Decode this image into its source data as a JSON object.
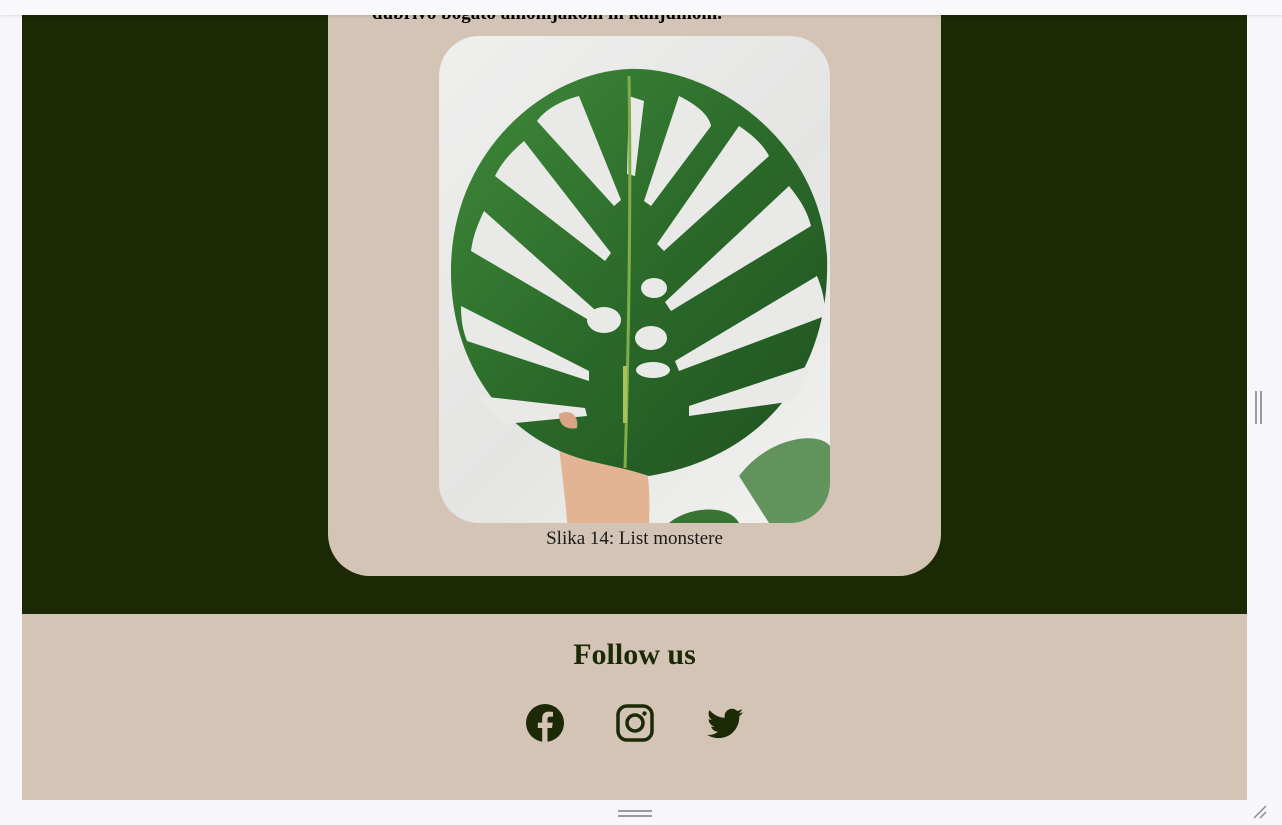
{
  "card": {
    "text": "dubrivo bogato amonijakom in kalijumom.",
    "image_alt": "List monstere",
    "caption": "Slika 14: List monstere"
  },
  "footer": {
    "title": "Follow us",
    "social": [
      {
        "name": "Facebook",
        "icon": "facebook-icon"
      },
      {
        "name": "Instagram",
        "icon": "instagram-icon"
      },
      {
        "name": "Twitter",
        "icon": "twitter-icon"
      }
    ]
  },
  "colors": {
    "dark_green": "#1b2905",
    "beige": "#d4c4b5",
    "leaf_green": "#2e6a2c"
  }
}
